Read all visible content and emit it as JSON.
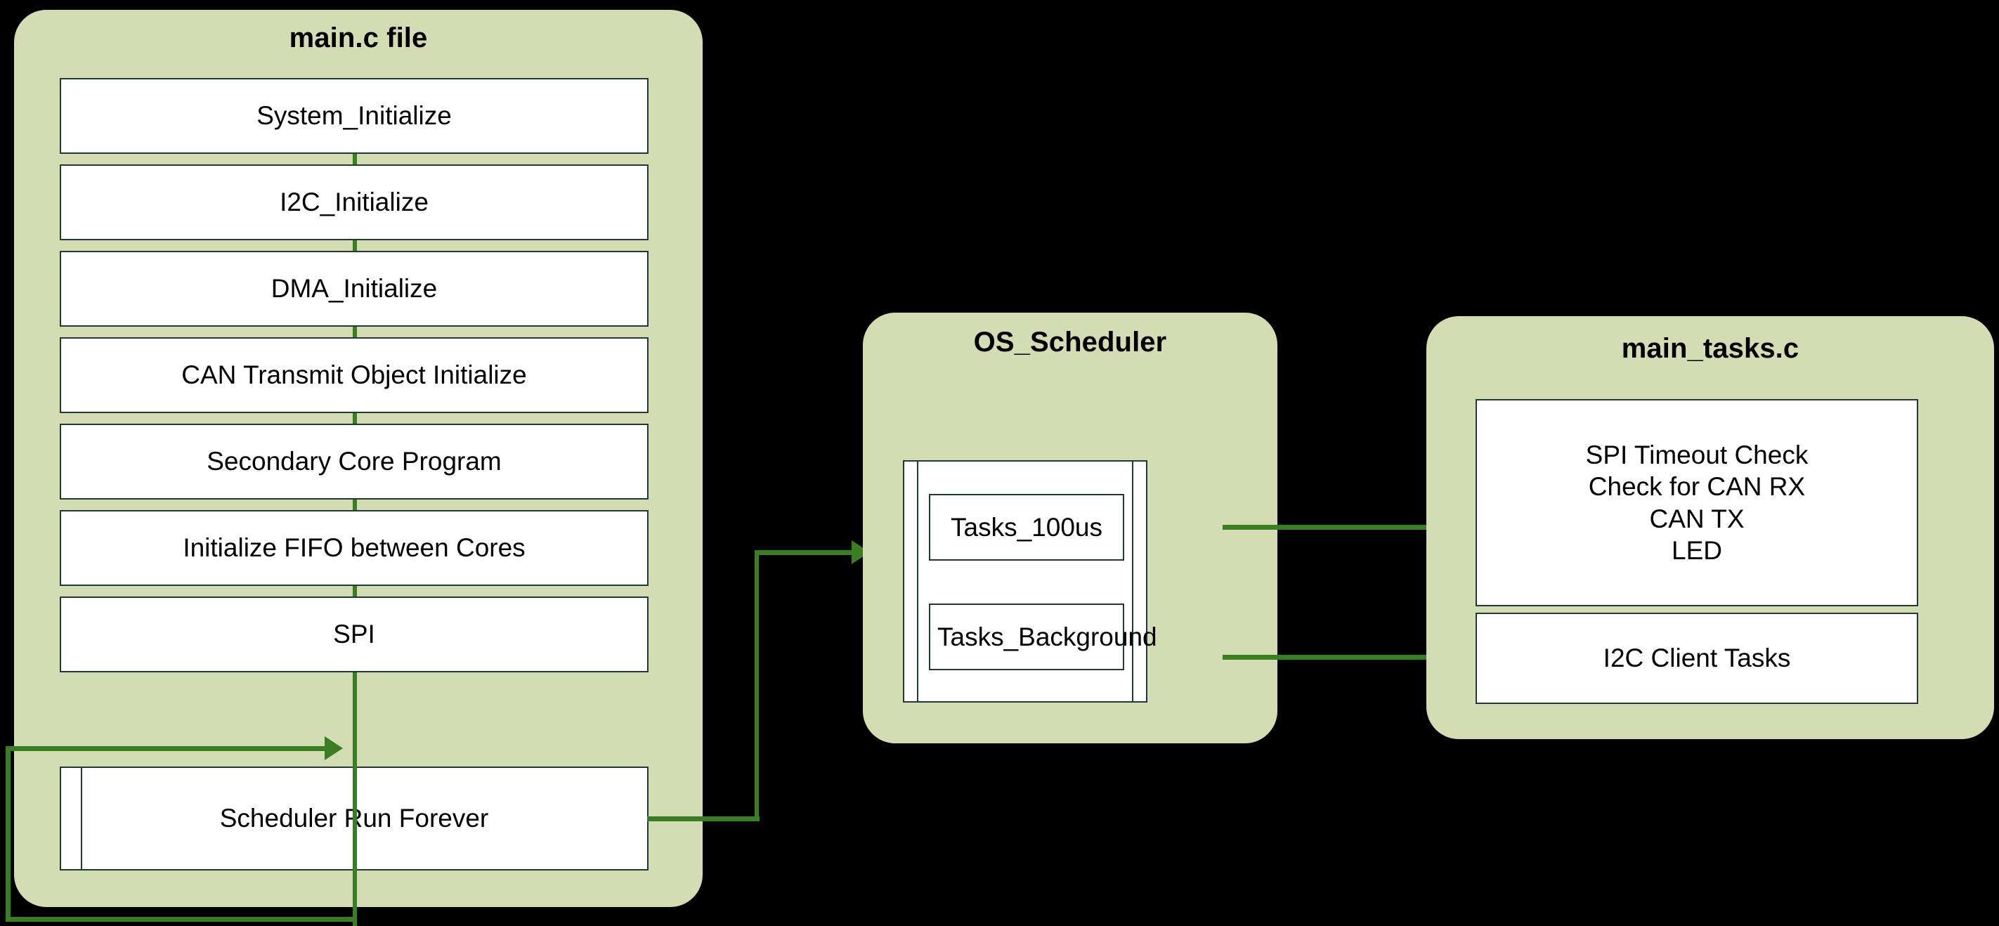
{
  "diagram": {
    "title": "Firmware main.c / OS_Scheduler / main_tasks.c flow",
    "accent_green": "#3a7d23",
    "panel_fill": "#d3dcb2",
    "box_border": "#1f3a34",
    "box_fill": "#ffffff",
    "background": "#000000"
  },
  "panels": {
    "main_c": {
      "title": "main.c file",
      "steps": [
        {
          "label": "System_Initialize"
        },
        {
          "label": "I2C_Initialize"
        },
        {
          "label": "DMA_Initialize"
        },
        {
          "label": "CAN Transmit Object Initialize"
        },
        {
          "label": "Secondary Core Program"
        },
        {
          "label": "Initialize FIFO between Cores"
        },
        {
          "label": "SPI"
        }
      ],
      "loop_box": {
        "label": "Scheduler Run Forever"
      }
    },
    "os_scheduler": {
      "title": "OS_Scheduler",
      "tasks": [
        {
          "label": "Tasks_100us"
        },
        {
          "label": "Tasks_Background"
        }
      ]
    },
    "main_tasks_c": {
      "title": "main_tasks.c",
      "blocks": [
        {
          "lines": [
            "SPI Timeout Check",
            "Check for CAN RX",
            "CAN TX",
            "LED"
          ]
        },
        {
          "lines": [
            "I2C Client Tasks"
          ]
        }
      ]
    }
  },
  "connectors": [
    {
      "name": "scheduler-run-forever-to-os-scheduler",
      "from": "Scheduler Run Forever",
      "to": "OS_Scheduler"
    },
    {
      "name": "tasks-100us-to-spi-timeout-block",
      "from": "Tasks_100us",
      "to": "SPI Timeout Check / Check for CAN RX / CAN TX / LED"
    },
    {
      "name": "tasks-background-to-i2c-client-tasks",
      "from": "Tasks_Background",
      "to": "I2C Client Tasks"
    },
    {
      "name": "loop-back-to-scheduler-run-forever",
      "from": "SPI chain bottom",
      "to": "Scheduler Run Forever"
    }
  ]
}
